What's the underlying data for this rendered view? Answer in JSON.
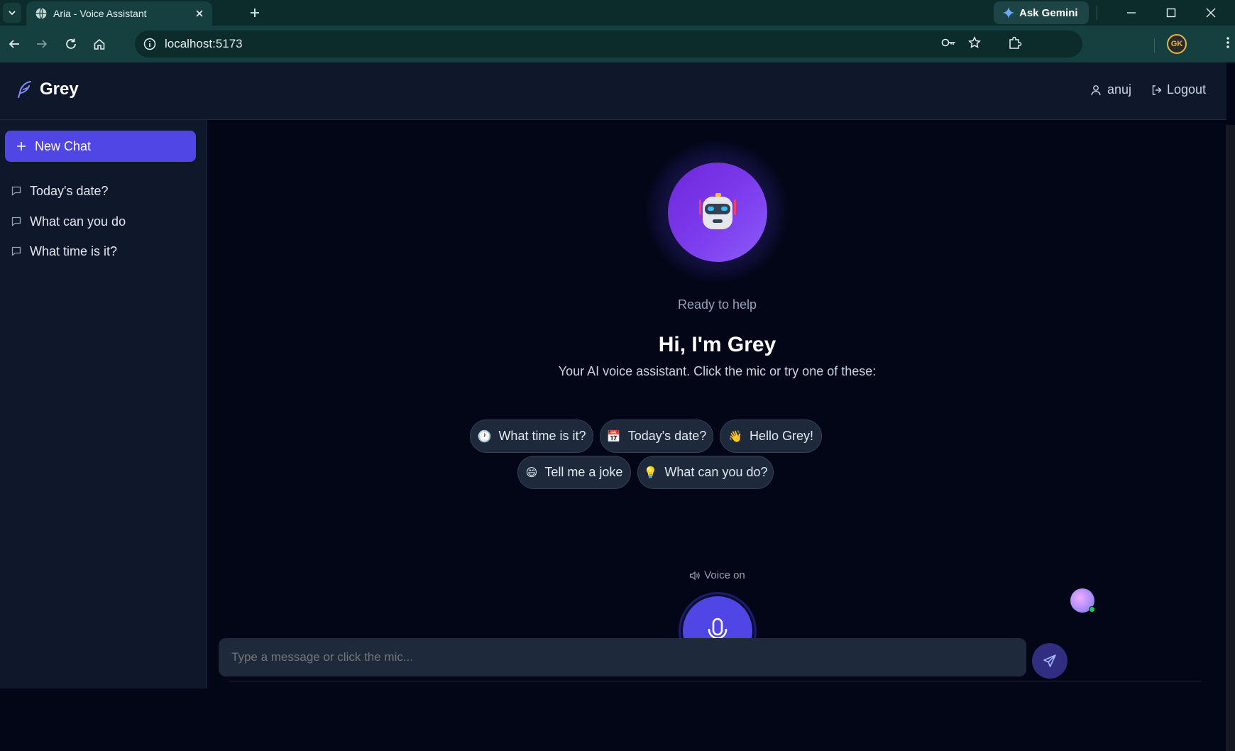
{
  "browser": {
    "tab_title": "Aria - Voice Assistant",
    "url": "localhost:5173",
    "gemini_label": "Ask Gemini",
    "profile_initials": "GK"
  },
  "header": {
    "brand": "Grey",
    "username": "anuj",
    "logout_label": "Logout"
  },
  "sidebar": {
    "new_chat_label": "New Chat",
    "history": [
      {
        "label": "Today's date?"
      },
      {
        "label": "What can you do"
      },
      {
        "label": "What time is it?"
      }
    ]
  },
  "main": {
    "status": "Ready to help",
    "greeting": "Hi, I'm Grey",
    "subtitle": "Your AI voice assistant. Click the mic or try one of these:",
    "suggestions": [
      {
        "emoji": "🕐",
        "label": "What time is it?"
      },
      {
        "emoji": "📅",
        "label": "Today's date?"
      },
      {
        "emoji": "👋",
        "label": "Hello Grey!"
      },
      {
        "emoji": "😄",
        "label": "Tell me a joke"
      },
      {
        "emoji": "💡",
        "label": "What can you do?"
      }
    ],
    "voice_label": "Voice on",
    "input_placeholder": "Type a message or click the mic..."
  },
  "colors": {
    "accent": "#4f46e5",
    "background": "#020617",
    "panel": "#0f172a",
    "chip": "#1e293b"
  }
}
